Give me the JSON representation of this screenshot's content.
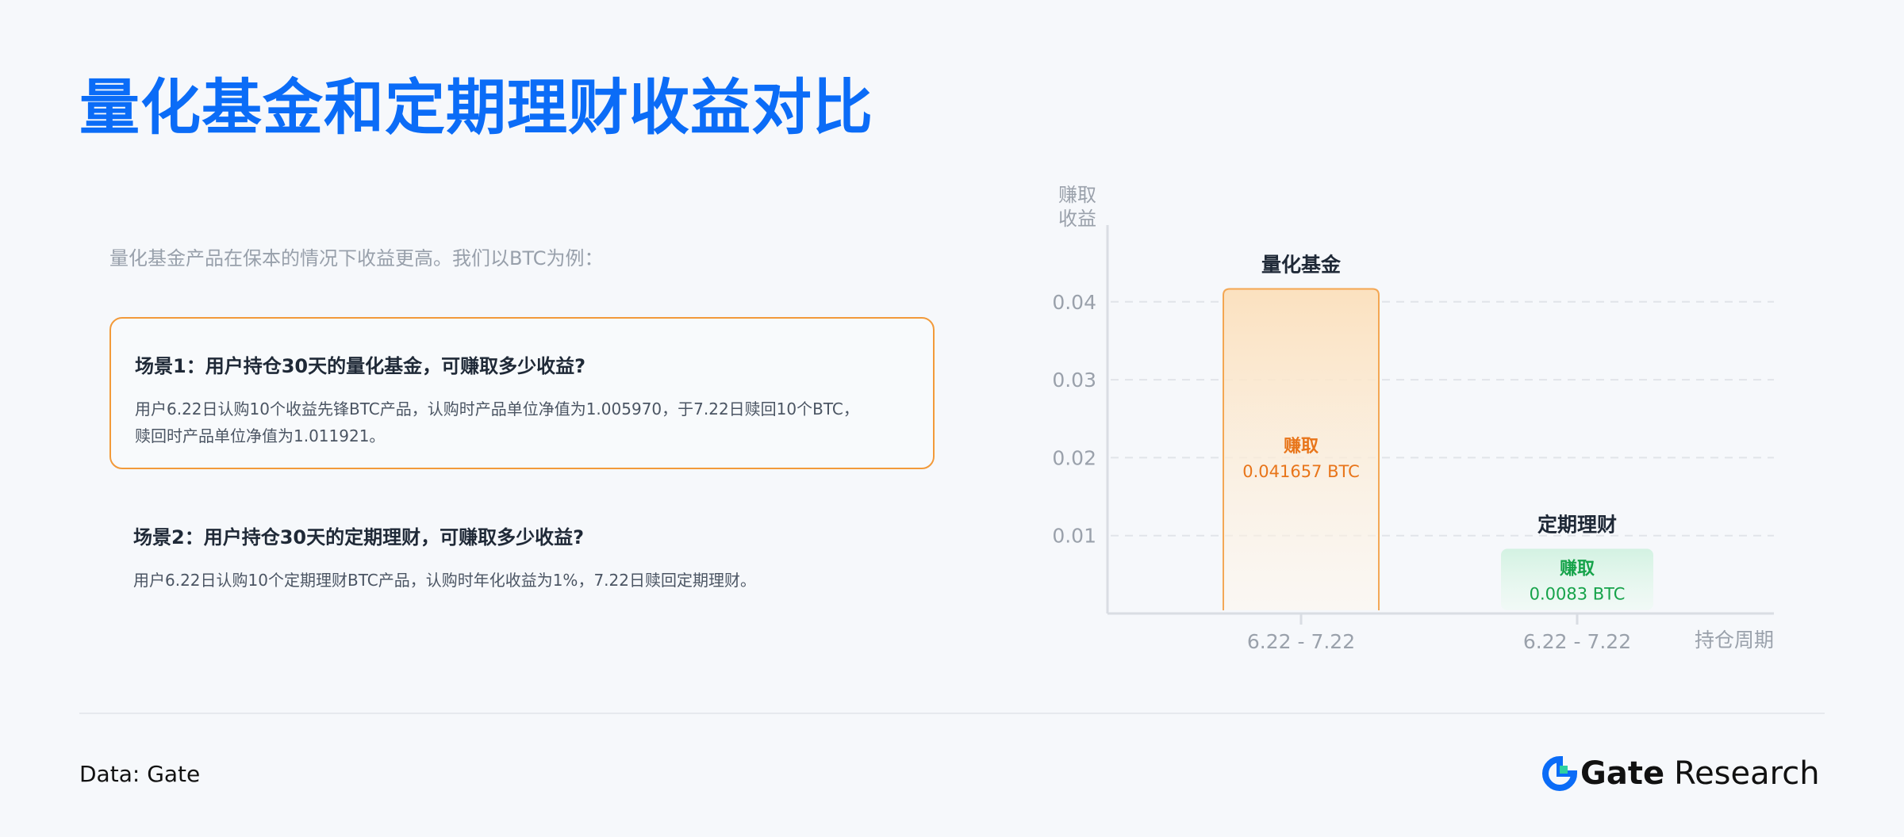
{
  "title": "量化基金和定期理财收益对比",
  "intro": "量化基金产品在保本的情况下收益更高。我们以BTC为例：",
  "scenarios": [
    {
      "title": "场景1：用户持仓30天的量化基金，可赚取多少收益?",
      "body": "用户6.22日认购10个收益先锋BTC产品，认购时产品单位净值为1.005970，于7.22日赎回10个BTC，\n赎回时产品单位净值为1.011921。"
    },
    {
      "title": "场景2：用户持仓30天的定期理财，可赚取多少收益?",
      "body": "用户6.22日认购10个定期理财BTC产品，认购时年化收益为1%，7.22日赎回定期理财。"
    }
  ],
  "chart_data": {
    "type": "bar",
    "ylabel": "赚取\n收益",
    "xlabel": "持仓周期",
    "yticks": [
      "0.01",
      "0.02",
      "0.03",
      "0.04"
    ],
    "ylim": [
      0,
      0.05
    ],
    "grid": true,
    "bars": [
      {
        "name": "量化基金",
        "category": "6.22 - 7.22",
        "value": 0.041657,
        "label_top": "赚取",
        "label_bottom": "0.041657 BTC",
        "color": "#f29a3a",
        "text_color": "#e8751a"
      },
      {
        "name": "定期理财",
        "category": "6.22 - 7.22",
        "value": 0.0083,
        "label_top": "赚取",
        "label_bottom": "0.0083 BTC",
        "color": "#2fbf7f",
        "text_color": "#16a34a"
      }
    ]
  },
  "footer": {
    "source": "Data: Gate",
    "brand_name": "Gate",
    "brand_sub": "Research",
    "brand_color": "#0b6cf7"
  }
}
